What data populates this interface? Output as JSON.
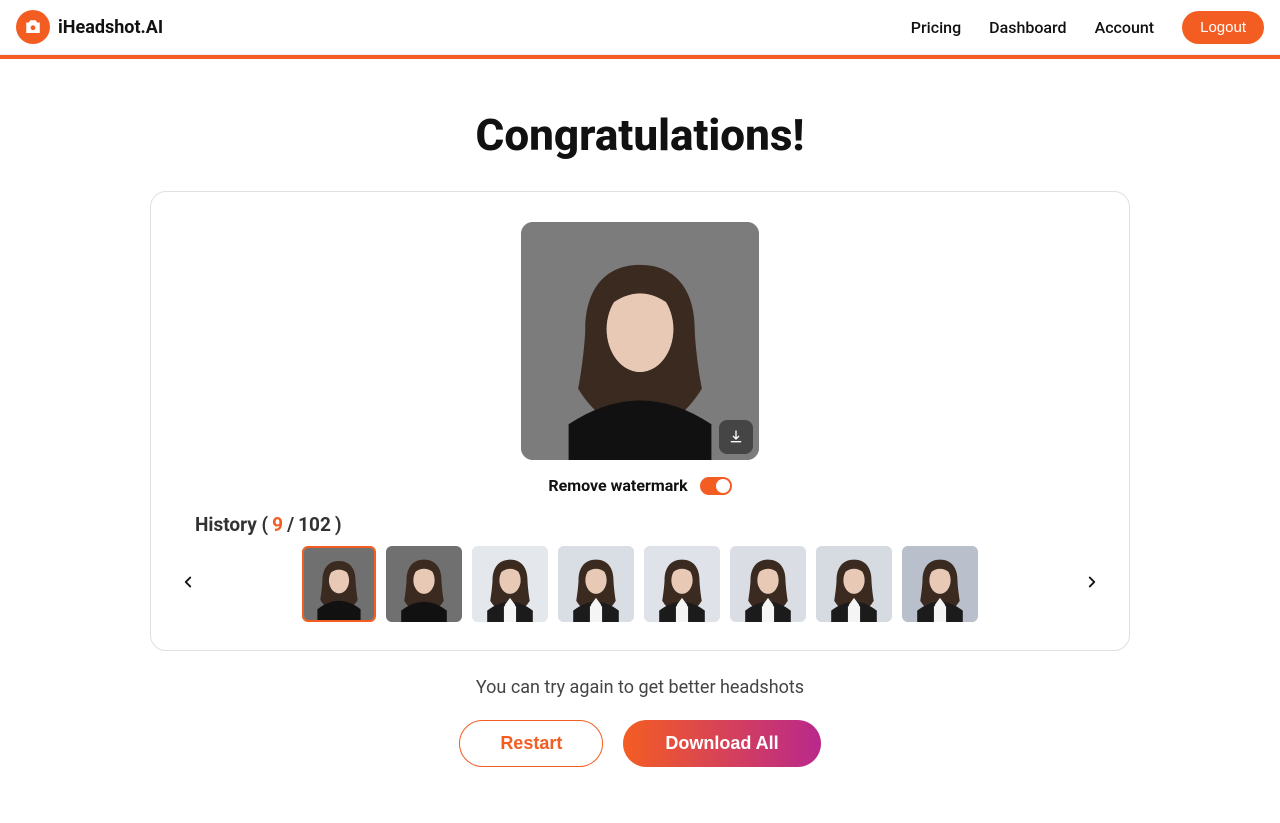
{
  "brand": "iHeadshot.AI",
  "nav": {
    "pricing": "Pricing",
    "dashboard": "Dashboard",
    "account": "Account",
    "logout": "Logout"
  },
  "title": "Congratulations!",
  "watermark_label": "Remove watermark",
  "history": {
    "prefix": "History (",
    "current": "9",
    "sep": "/",
    "total": "102",
    "suffix": ")"
  },
  "tip": "You can try again to get better headshots",
  "buttons": {
    "restart": "Restart",
    "download_all": "Download All"
  },
  "thumbs": [
    {
      "bg": "#707070",
      "top": "black",
      "selected": true
    },
    {
      "bg": "#707070",
      "top": "black"
    },
    {
      "bg": "#e4e7ec",
      "top": "suit"
    },
    {
      "bg": "#d9dde4",
      "top": "suit"
    },
    {
      "bg": "#dfe3e9",
      "top": "suit"
    },
    {
      "bg": "#dadee4",
      "top": "suit"
    },
    {
      "bg": "#d6dae1",
      "top": "suit"
    },
    {
      "bg": "#b9c0cb",
      "top": "suit"
    }
  ]
}
